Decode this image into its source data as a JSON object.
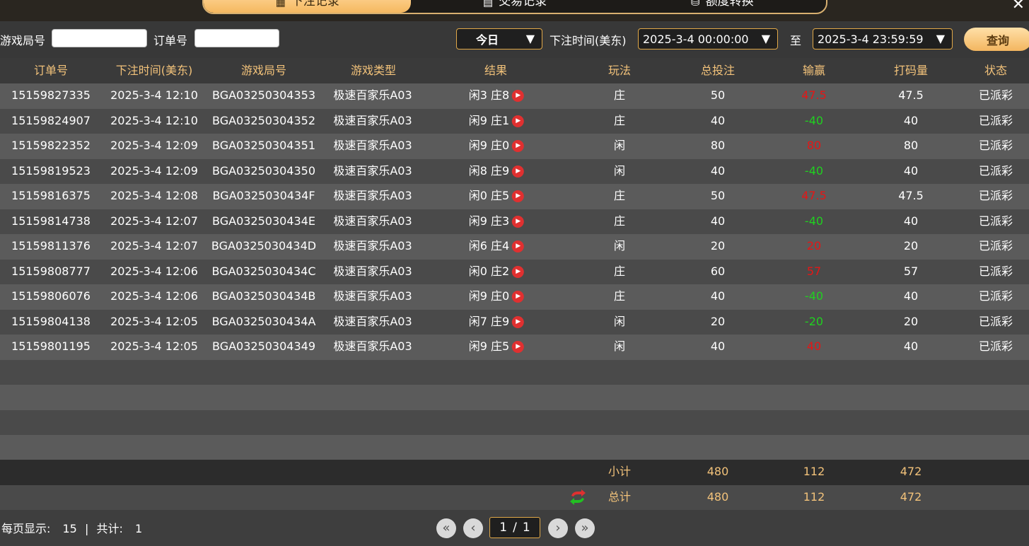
{
  "tabs": [
    {
      "label": "下注记录",
      "icon": "calendar-icon",
      "active": true
    },
    {
      "label": "交易记录",
      "icon": "document-icon",
      "active": false
    },
    {
      "label": "额度转换",
      "icon": "coin-transfer-icon",
      "active": false
    }
  ],
  "close_label": "✕",
  "filters": {
    "round_label": "游戏局号",
    "round_value": "",
    "order_label": "订单号",
    "order_value": "",
    "range_select": "今日",
    "time_label": "下注时间(美东)",
    "start_time": "2025-3-4 00:00:00",
    "to_label": "至",
    "end_time": "2025-3-4 23:59:59",
    "query_label": "查询"
  },
  "headers": [
    "订单号",
    "下注时间(美东)",
    "游戏局号",
    "游戏类型",
    "结果",
    "玩法",
    "总投注",
    "输赢",
    "打码量",
    "状态"
  ],
  "rows": [
    {
      "order": "15159827335",
      "time": "2025-3-4 12:10",
      "round": "BGA03250304353",
      "game": "极速百家乐A03",
      "result": "闲3 庄8",
      "bet": "庄",
      "total": "50",
      "winloss": "47.5",
      "wl_type": "win",
      "turnover": "47.5",
      "status": "已派彩"
    },
    {
      "order": "15159824907",
      "time": "2025-3-4 12:10",
      "round": "BGA03250304352",
      "game": "极速百家乐A03",
      "result": "闲9 庄1",
      "bet": "庄",
      "total": "40",
      "winloss": "-40",
      "wl_type": "lose",
      "turnover": "40",
      "status": "已派彩"
    },
    {
      "order": "15159822352",
      "time": "2025-3-4 12:09",
      "round": "BGA03250304351",
      "game": "极速百家乐A03",
      "result": "闲9 庄0",
      "bet": "闲",
      "total": "80",
      "winloss": "80",
      "wl_type": "win",
      "turnover": "80",
      "status": "已派彩"
    },
    {
      "order": "15159819523",
      "time": "2025-3-4 12:09",
      "round": "BGA03250304350",
      "game": "极速百家乐A03",
      "result": "闲8 庄9",
      "bet": "闲",
      "total": "40",
      "winloss": "-40",
      "wl_type": "lose",
      "turnover": "40",
      "status": "已派彩"
    },
    {
      "order": "15159816375",
      "time": "2025-3-4 12:08",
      "round": "BGA0325030434F",
      "game": "极速百家乐A03",
      "result": "闲0 庄5",
      "bet": "庄",
      "total": "50",
      "winloss": "47.5",
      "wl_type": "win",
      "turnover": "47.5",
      "status": "已派彩"
    },
    {
      "order": "15159814738",
      "time": "2025-3-4 12:07",
      "round": "BGA0325030434E",
      "game": "极速百家乐A03",
      "result": "闲9 庄3",
      "bet": "庄",
      "total": "40",
      "winloss": "-40",
      "wl_type": "lose",
      "turnover": "40",
      "status": "已派彩"
    },
    {
      "order": "15159811376",
      "time": "2025-3-4 12:07",
      "round": "BGA0325030434D",
      "game": "极速百家乐A03",
      "result": "闲6 庄4",
      "bet": "闲",
      "total": "20",
      "winloss": "20",
      "wl_type": "win",
      "turnover": "20",
      "status": "已派彩"
    },
    {
      "order": "15159808777",
      "time": "2025-3-4 12:06",
      "round": "BGA0325030434C",
      "game": "极速百家乐A03",
      "result": "闲0 庄2",
      "bet": "庄",
      "total": "60",
      "winloss": "57",
      "wl_type": "win",
      "turnover": "57",
      "status": "已派彩"
    },
    {
      "order": "15159806076",
      "time": "2025-3-4 12:06",
      "round": "BGA0325030434B",
      "game": "极速百家乐A03",
      "result": "闲9 庄0",
      "bet": "庄",
      "total": "40",
      "winloss": "-40",
      "wl_type": "lose",
      "turnover": "40",
      "status": "已派彩"
    },
    {
      "order": "15159804138",
      "time": "2025-3-4 12:05",
      "round": "BGA0325030434A",
      "game": "极速百家乐A03",
      "result": "闲7 庄9",
      "bet": "闲",
      "total": "20",
      "winloss": "-20",
      "wl_type": "lose",
      "turnover": "20",
      "status": "已派彩"
    },
    {
      "order": "15159801195",
      "time": "2025-3-4 12:05",
      "round": "BGA03250304349",
      "game": "极速百家乐A03",
      "result": "闲9 庄5",
      "bet": "闲",
      "total": "40",
      "winloss": "40",
      "wl_type": "win",
      "turnover": "40",
      "status": "已派彩"
    }
  ],
  "empty_rows": 4,
  "subtotal": {
    "label": "小计",
    "total": "480",
    "winloss": "112",
    "turnover": "472"
  },
  "grand_total": {
    "label": "总计",
    "total": "480",
    "winloss": "112",
    "turnover": "472"
  },
  "pagination": {
    "per_page_label": "每页显示:",
    "per_page": "15",
    "sep": "|",
    "count_label": "共计:",
    "count": "1",
    "current": "1",
    "slash": "/",
    "pages": "1"
  },
  "colors": {
    "accent": "#f2c27a",
    "win": "#e51616",
    "lose": "#20d020"
  }
}
